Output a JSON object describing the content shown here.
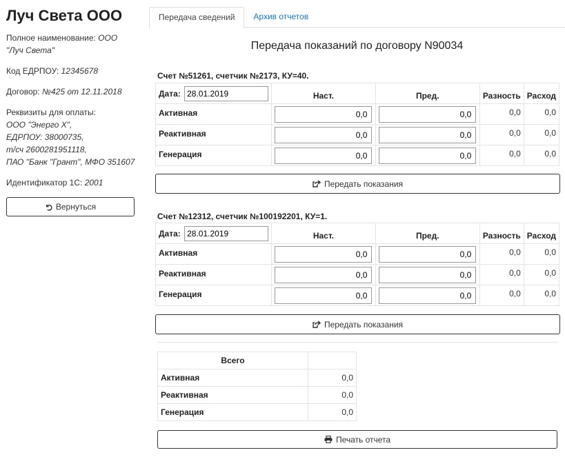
{
  "sidebar": {
    "company_name": "Луч Света ООО",
    "full_name_label": "Полное наименование:",
    "full_name_value": "ООО \"Луч Света\"",
    "edrpou_label": "Код ЕДРПОУ:",
    "edrpou_value": "12345678",
    "contract_label": "Договор:",
    "contract_value": "№425 от 12.11.2018",
    "requisites_label": "Реквизиты для оплаты:",
    "requisites_lines": [
      "ООО \"Энерго Х\",",
      "ЕДРПОУ: 38000735,",
      "т/сч 2600281951118,",
      "ПАО \"Банк \"Грант\", МФО 351607"
    ],
    "id1c_label": "Идентификатор 1С:",
    "id1c_value": "2001",
    "back_button": "Вернуться"
  },
  "tabs": [
    {
      "label": "Передача сведений",
      "active": true
    },
    {
      "label": "Архив отчетов",
      "active": false
    }
  ],
  "page_title": "Передача показаний по договору N90034",
  "columns": {
    "date_label": "Дата:",
    "current": "Наст.",
    "previous": "Пред.",
    "difference": "Разность",
    "consumption": "Расход"
  },
  "meters": [
    {
      "title": "Счет №51261, счетчик №2173, КУ=40.",
      "date": "28.01.2019",
      "rows": [
        {
          "label": "Активная",
          "current": "0,0",
          "previous": "0,0",
          "difference": "0,0",
          "consumption": "0,0"
        },
        {
          "label": "Реактивная",
          "current": "0,0",
          "previous": "0,0",
          "difference": "0,0",
          "consumption": "0,0"
        },
        {
          "label": "Генерация",
          "current": "0,0",
          "previous": "0,0",
          "difference": "0,0",
          "consumption": "0,0"
        }
      ],
      "submit_label": "Передать показания"
    },
    {
      "title": "Счет №12312, счетчик №100192201, КУ=1.",
      "date": "28.01.2019",
      "rows": [
        {
          "label": "Активная",
          "current": "0,0",
          "previous": "0,0",
          "difference": "0,0",
          "consumption": "0,0"
        },
        {
          "label": "Реактивная",
          "current": "0,0",
          "previous": "0,0",
          "difference": "0,0",
          "consumption": "0,0"
        },
        {
          "label": "Генерация",
          "current": "0,0",
          "previous": "0,0",
          "difference": "0,0",
          "consumption": "0,0"
        }
      ],
      "submit_label": "Передать показания"
    }
  ],
  "totals": {
    "header": "Всего",
    "rows": [
      {
        "label": "Активная",
        "value": "0,0"
      },
      {
        "label": "Реактивная",
        "value": "0,0"
      },
      {
        "label": "Генерация",
        "value": "0,0"
      }
    ]
  },
  "print_button": "Печать отчета",
  "icons": {
    "back": "undo-icon",
    "submit": "share-square-icon",
    "print": "print-icon"
  },
  "colors": {
    "link": "#1a73c8",
    "text": "#333333",
    "border": "#e4e4e4"
  }
}
